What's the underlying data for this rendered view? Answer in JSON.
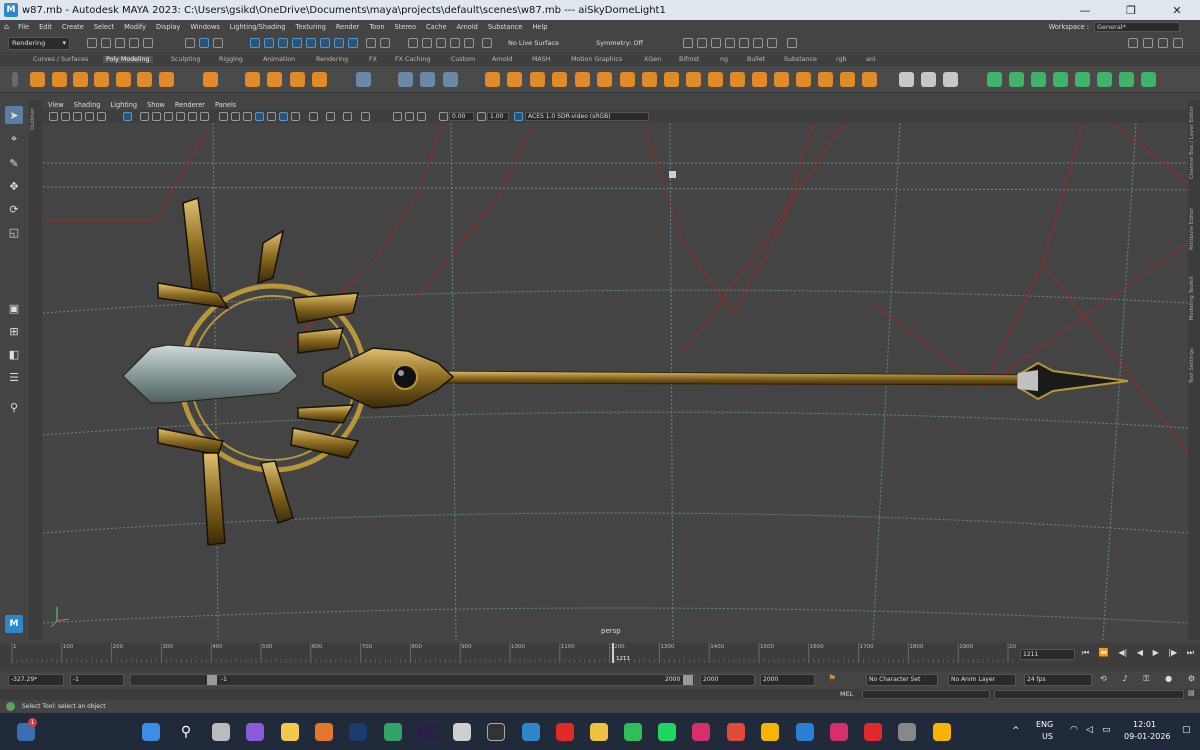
{
  "window": {
    "title": "w87.mb - Autodesk MAYA 2023: C:\\Users\\gsikd\\OneDrive\\Documents\\maya\\projects\\default\\scenes\\w87.mb   ---   aiSkyDomeLight1",
    "logo": "M",
    "min": "—",
    "max": "❐",
    "close": "✕"
  },
  "menu": {
    "items": [
      "File",
      "Edit",
      "Create",
      "Select",
      "Modify",
      "Display",
      "Windows",
      "Lighting/Shading",
      "Texturing",
      "Render",
      "Toon",
      "Stereo",
      "Cache",
      "Arnold",
      "Substance",
      "Help"
    ],
    "workspace_label": "Workspace :",
    "workspace_value": "General*"
  },
  "statusline": {
    "mode": "Rendering",
    "live_surface": "No Live Surface",
    "symmetry": "Symmetry: Off"
  },
  "shelf": {
    "tabs": [
      "Curves / Surfaces",
      "Poly Modeling",
      "Sculpting",
      "Rigging",
      "Animation",
      "Rendering",
      "FX",
      "FX Caching",
      "Custom",
      "Arnold",
      "MASH",
      "Motion Graphics",
      "XGen",
      "Bifrost",
      "ng",
      "Bullet",
      "Substance",
      "rgb",
      "ani"
    ],
    "active_tab": "Poly Modeling"
  },
  "viewport": {
    "menus": [
      "View",
      "Shading",
      "Lighting",
      "Show",
      "Renderer",
      "Panels"
    ],
    "exposure": "0.00",
    "gamma": "1.00",
    "color_space": "ACES 1.0 SDR-video (sRGB)",
    "camera_label": "persp"
  },
  "right_panels": [
    "Channel Box / Layer Editor",
    "Attribute Editor",
    "Modeling Toolkit",
    "Tool Settings"
  ],
  "outliner_label": "Outliner",
  "timeline": {
    "ticks": [
      "1",
      "100",
      "200",
      "300",
      "400",
      "500",
      "600",
      "700",
      "800",
      "900",
      "1000",
      "1100",
      "1200",
      "1300",
      "1400",
      "1500",
      "1600",
      "1700",
      "1800",
      "1900",
      "20"
    ],
    "current": "1211",
    "current_frame_field": "1211"
  },
  "range": {
    "start_field": "-327.29*",
    "start_inner": "-1",
    "slider_start": "-1",
    "slider_end": "2000",
    "end_field": "2000",
    "end_field2": "2000",
    "character_set": "No Character Set",
    "anim_layer": "No Anim Layer",
    "fps": "24 fps"
  },
  "cmdline": {
    "label": "MEL"
  },
  "help": {
    "text": "Select Tool: select an object"
  },
  "taskbar": {
    "lang": "ENG",
    "region": "US",
    "time": "12:01",
    "date": "09-01-2026",
    "badge": "1"
  },
  "colors": {
    "grid": "#5f8f8f",
    "light": "#b02020",
    "gold": "#b8963a",
    "blade": "#9fb0b0"
  }
}
